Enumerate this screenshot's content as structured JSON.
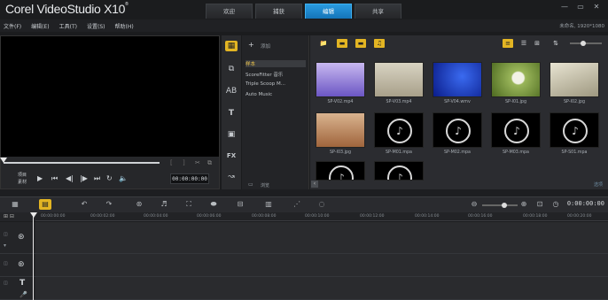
{
  "app": {
    "brand": "Corel VideoStudio X10",
    "brand_sup": "®",
    "project_info": "未命名, 1920*1080"
  },
  "window_controls": [
    "—",
    "▭",
    "✕"
  ],
  "tabs": [
    {
      "label": "欢迎",
      "active": false
    },
    {
      "label": "捕获",
      "active": false
    },
    {
      "label": "编辑",
      "active": true
    },
    {
      "label": "共享",
      "active": false
    }
  ],
  "menu": [
    "文件(F)",
    "编辑(E)",
    "工具(T)",
    "设置(S)",
    "帮助(H)"
  ],
  "player": {
    "project_label": "项目",
    "clip_label": "素材",
    "timecode": "00:00:00:00",
    "controls": [
      "play-icon",
      "start-icon",
      "prev-frame-icon",
      "next-frame-icon",
      "end-icon",
      "repeat-icon",
      "volume-icon"
    ]
  },
  "library": {
    "add_label": "添加",
    "browse_label": "浏览",
    "folders": [
      {
        "label": "样本",
        "selected": true
      },
      {
        "label": "ScoreFitter 音乐",
        "selected": false
      },
      {
        "label": "Triple Scoop M...",
        "selected": false
      },
      {
        "label": "Auto Music",
        "selected": false
      }
    ],
    "thumbnails": [
      {
        "label": "SP-V02.mp4",
        "kind": "video",
        "color": "#8e7bd6"
      },
      {
        "label": "SP-V03.mp4",
        "kind": "video",
        "color": "#cfc9b8"
      },
      {
        "label": "SP-V04.wmv",
        "kind": "video",
        "color": "#1a3fd6"
      },
      {
        "label": "SP-I01.jpg",
        "kind": "image",
        "color": "#8aa54a"
      },
      {
        "label": "SP-I02.jpg",
        "kind": "image",
        "color": "#c9c3ab"
      },
      {
        "label": "SP-I03.jpg",
        "kind": "image",
        "color": "#c28a5c"
      },
      {
        "label": "SP-M01.mpa",
        "kind": "audio"
      },
      {
        "label": "SP-M02.mpa",
        "kind": "audio"
      },
      {
        "label": "SP-M03.mpa",
        "kind": "audio"
      },
      {
        "label": "SP-S01.mpa",
        "kind": "audio"
      },
      {
        "label": "",
        "kind": "audio"
      },
      {
        "label": "",
        "kind": "audio"
      }
    ],
    "options_label": "选项"
  },
  "timeline": {
    "timecode": "0:00:00:00",
    "ruler": [
      "00:00:00:00",
      "00:00:02:00",
      "00:00:04:00",
      "00:00:06:00",
      "00:00:08:00",
      "00:00:10:00",
      "00:00:12:00",
      "00:00:14:00",
      "00:00:16:00",
      "00:00:18:00",
      "00:00:20:00"
    ]
  }
}
